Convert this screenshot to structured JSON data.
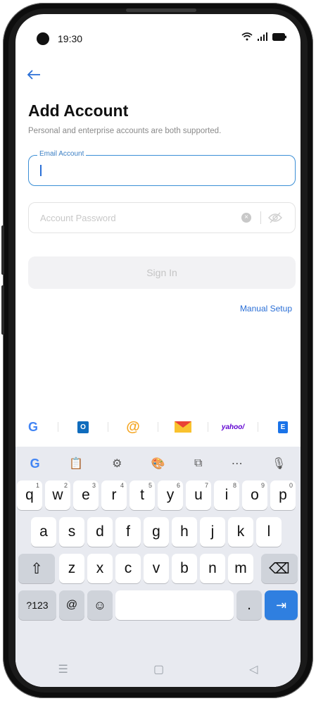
{
  "status_bar": {
    "time": "19:30"
  },
  "header": {
    "title": "Add Account",
    "subtitle": "Personal and enterprise accounts are both supported."
  },
  "email": {
    "label": "Email Account",
    "value": ""
  },
  "password": {
    "placeholder": "Account Password"
  },
  "actions": {
    "sign_in": "Sign In",
    "manual_setup": "Manual Setup"
  },
  "providers": [
    {
      "name": "google-icon",
      "text": "G",
      "color": "#4285F4"
    },
    {
      "name": "outlook-icon",
      "text": "O",
      "color": "#0F6CBD"
    },
    {
      "name": "at-mail-icon",
      "text": "@",
      "color": "#F5A623"
    },
    {
      "name": "gmail-envelope-icon",
      "text": "✉",
      "color": "#E94235"
    },
    {
      "name": "yahoo-icon",
      "text": "yahoo/",
      "color": "#5F01D1"
    },
    {
      "name": "exchange-icon",
      "text": "E",
      "color": "#1A73E8"
    }
  ],
  "keyboard": {
    "row1": [
      {
        "k": "q",
        "n": "1"
      },
      {
        "k": "w",
        "n": "2"
      },
      {
        "k": "e",
        "n": "3"
      },
      {
        "k": "r",
        "n": "4"
      },
      {
        "k": "t",
        "n": "5"
      },
      {
        "k": "y",
        "n": "6"
      },
      {
        "k": "u",
        "n": "7"
      },
      {
        "k": "i",
        "n": "8"
      },
      {
        "k": "o",
        "n": "9"
      },
      {
        "k": "p",
        "n": "0"
      }
    ],
    "row2": [
      "a",
      "s",
      "d",
      "f",
      "g",
      "h",
      "j",
      "k",
      "l"
    ],
    "row3": [
      "z",
      "x",
      "c",
      "v",
      "b",
      "n",
      "m"
    ],
    "numbers_key": "?123",
    "at_key": "@",
    "period_key": "."
  }
}
